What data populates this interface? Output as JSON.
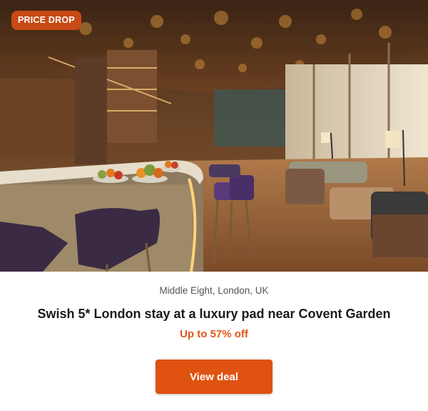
{
  "deal": {
    "badge": "PRICE DROP",
    "location": "Middle Eight, London, UK",
    "title": "Swish 5* London stay at a luxury pad near Covent Garden",
    "discount": "Up to 57% off",
    "cta_label": "View deal"
  },
  "colors": {
    "badge_bg": "#c94a16",
    "accent": "#e2541a",
    "button_bg": "#df5210"
  }
}
